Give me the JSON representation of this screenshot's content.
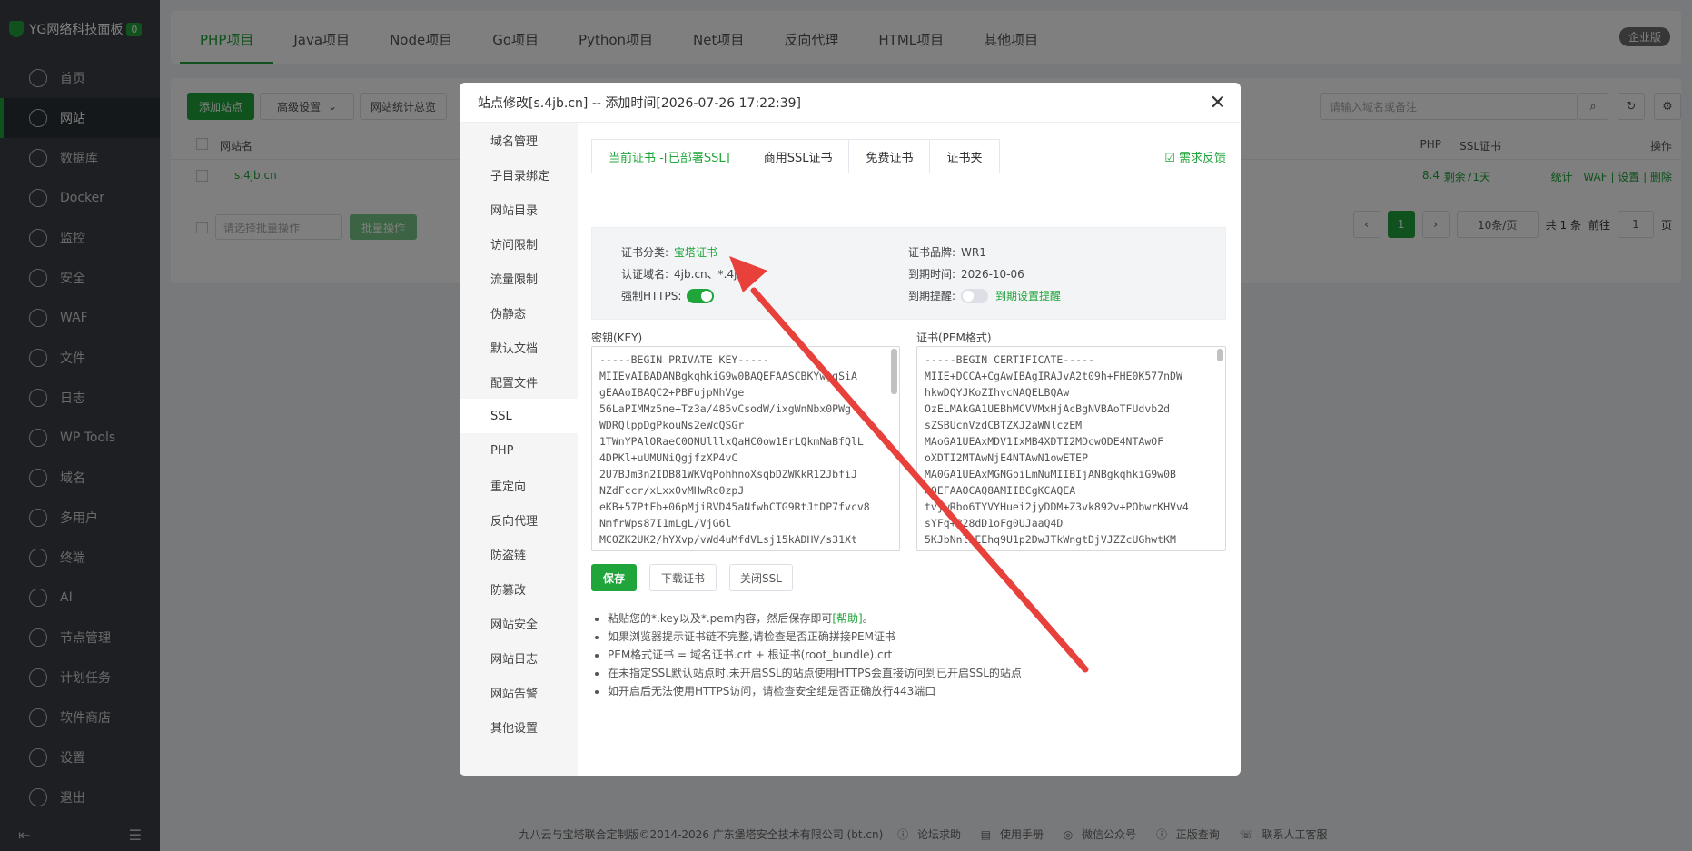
{
  "sidebar": {
    "brand": "YG网络科技面板",
    "badge": "0",
    "items": [
      {
        "label": "首页",
        "icon": "home-icon"
      },
      {
        "label": "网站",
        "icon": "globe-icon",
        "active": true
      },
      {
        "label": "数据库",
        "icon": "database-icon"
      },
      {
        "label": "Docker",
        "icon": "docker-icon"
      },
      {
        "label": "监控",
        "icon": "monitor-icon"
      },
      {
        "label": "安全",
        "icon": "shield-icon"
      },
      {
        "label": "WAF",
        "icon": "waf-icon"
      },
      {
        "label": "文件",
        "icon": "folder-icon"
      },
      {
        "label": "日志",
        "icon": "log-icon"
      },
      {
        "label": "WP Tools",
        "icon": "wordpress-icon"
      },
      {
        "label": "域名",
        "icon": "domain-icon"
      },
      {
        "label": "多用户",
        "icon": "users-icon"
      },
      {
        "label": "终端",
        "icon": "terminal-icon"
      },
      {
        "label": "AI",
        "icon": "ai-icon"
      },
      {
        "label": "节点管理",
        "icon": "node-icon"
      },
      {
        "label": "计划任务",
        "icon": "calendar-icon"
      },
      {
        "label": "软件商店",
        "icon": "store-icon"
      },
      {
        "label": "设置",
        "icon": "gear-icon"
      },
      {
        "label": "退出",
        "icon": "logout-icon"
      }
    ]
  },
  "topbar": {
    "tabs": [
      "PHP项目",
      "Java项目",
      "Node项目",
      "Go项目",
      "Python项目",
      "Net项目",
      "反向代理",
      "HTML项目",
      "其他项目"
    ],
    "enterprise": "企业版"
  },
  "panel": {
    "add_site": "添加站点",
    "advanced": "高级设置",
    "stats": "网站统计总览",
    "search_placeholder": "请输入域名或备注",
    "col_name": "网站名",
    "col_php": "PHP",
    "col_ssl": "SSL证书",
    "col_ops": "操作",
    "row_name": "s.4jb.cn",
    "row_php": "8.4",
    "row_ssl": "剩余71天",
    "row_ops": [
      "统计",
      "WAF",
      "设置",
      "删除"
    ],
    "batch_placeholder": "请选择批量操作",
    "batch_btn": "批量操作",
    "page_current": "1",
    "page_size": "10条/页",
    "total": "共 1 条",
    "goto": "前往",
    "goto_page": "1",
    "page_unit": "页"
  },
  "modal": {
    "title": "站点修改[s.4jb.cn] -- 添加时间[2026-07-26 17:22:39]",
    "side_items": [
      "域名管理",
      "子目录绑定",
      "网站目录",
      "访问限制",
      "流量限制",
      "伪静态",
      "默认文档",
      "配置文件",
      "SSL",
      "PHP",
      "重定向",
      "反向代理",
      "防盗链",
      "防篡改",
      "网站安全",
      "网站日志",
      "网站告警",
      "其他设置"
    ],
    "active_side": "SSL",
    "ssl_tabs": [
      "当前证书 -[已部署SSL]",
      "商用SSL证书",
      "免费证书",
      "证书夹"
    ],
    "feedback": "需求反馈",
    "cert_type_label": "证书分类:",
    "cert_type": "宝塔证书",
    "domain_label": "认证域名:",
    "domain": "4jb.cn、*.4jb.cn",
    "force_https_label": "强制HTTPS:",
    "force_https": true,
    "brand_label": "证书品牌:",
    "brand": "WR1",
    "expire_label": "到期时间:",
    "expire": "2026-10-06",
    "remind_label": "到期提醒:",
    "remind": false,
    "remind_link": "到期设置提醒",
    "key_label": "密钥(KEY)",
    "pem_label": "证书(PEM格式)",
    "key_text": "-----BEGIN PRIVATE KEY-----\nMIIEvAIBADANBgkqhkiG9w0BAQEFAASCBKYwggSiA\ngEAAoIBAQC2+PBFujpNhVge\n56LaPIMMz5ne+Tz3a/485vCsodW/ixgWnNbx0PWg\nWDRQlppDgPkouNs2eWcQSGr\n1TWnYPAlORaeC0ONUlllxQaHC0ow1ErLQkmNaBfQlL\n4DPKl+uUMUNiQgjfzXP4vC\n2U7BJm3n2IDB81WKVqPohhnoXsqbDZWKkR12JbfiJ\nNZdFccr/xLxx0vMHwRc0zpJ\neKB+57PtFb+06pMjiRVD45aNfwhCTG9RtJtDP7fvcv8\nNmfrWps87I1mLgL/VjG6l\nMCOZK2UK2/hYXvp/vWd4uMfdVLsj15kADHV/s31Xt",
    "pem_text": "-----BEGIN CERTIFICATE-----\nMIIE+DCCA+CgAwIBAgIRAJvA2t09h+FHE0K577nDW\nhkwDQYJKoZIhvcNAQELBQAw\nOzELMAkGA1UEBhMCVVMxHjAcBgNVBAoTFUdvb2d\nsZSBUcnVzdCBTZXJ2aWNlczEM\nMAoGA1UEAxMDV1IxMB4XDTI2MDcwODE4NTAwOF\noXDTI2MTAwNjE4NTAwN1owETEP\nMA0GA1UEAxMGNGpiLmNuMIIBIjANBgkqhkiG9w0B\nAQEFAAOCAQ8AMIIBCgKCAQEA\ntvjwRbo6TYVYHuei2jyDDM+Z3vk892v+PObwrKHVv4\nsYFq+B28dD1oFg0UJaaQ4D\n5KJbNnlnEEhq9U1p2DwJTkWngtDjVJZZcUGhwtKM",
    "btn_save": "保存",
    "btn_download": "下载证书",
    "btn_close_ssl": "关闭SSL",
    "notes": [
      {
        "text": "粘贴您的*.key以及*.pem内容，然后保存即可",
        "link": "[帮助]",
        "tail": "。"
      },
      {
        "text": "如果浏览器提示证书链不完整,请检查是否正确拼接PEM证书"
      },
      {
        "text": "PEM格式证书 = 域名证书.crt + 根证书(root_bundle).crt"
      },
      {
        "text": "在未指定SSL默认站点时,未开启SSL的站点使用HTTPS会直接访问到已开启SSL的站点"
      },
      {
        "text": "如开启后无法使用HTTPS访问，请检查安全组是否正确放行443端口"
      }
    ]
  },
  "footer": {
    "copyright": "九八云与宝塔联合定制版©2014-2026 广东堡塔安全技术有限公司 (bt.cn)",
    "links": [
      "论坛求助",
      "使用手册",
      "微信公众号",
      "正版查询",
      "联系人工客服"
    ]
  },
  "colors": {
    "accent": "#20a53a",
    "sidebar": "#3a3f44",
    "arrow": "#e8403a"
  }
}
